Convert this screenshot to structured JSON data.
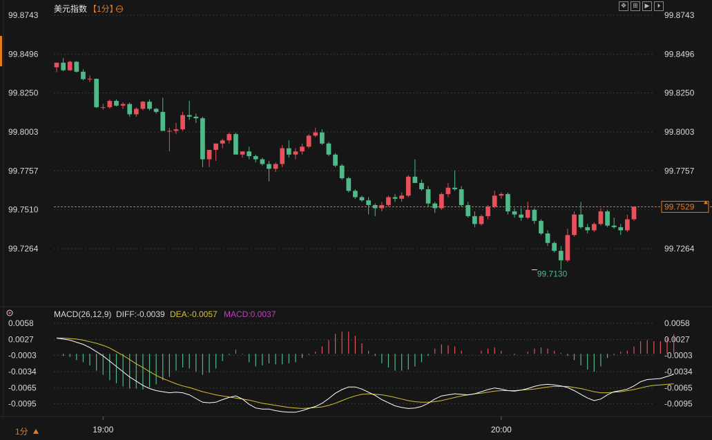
{
  "header": {
    "title": "美元指数",
    "period_tag": "【1分】",
    "crosshair_icon": "crosshair-icon"
  },
  "toolbar": {
    "buttons": [
      "fullscreen-icon",
      "grid-icon",
      "play-icon",
      "step-forward-icon"
    ]
  },
  "footer": {
    "period_label": "1分",
    "period_icon": "caret-up-icon"
  },
  "colors": {
    "up": "#e8505b",
    "down": "#4fb98a",
    "diff": "#ffffff",
    "dea": "#d7c531",
    "macd": "#c33ec3",
    "last_price": "#e87a1e"
  },
  "macd_legend": {
    "name": "MACD(26,12,9)",
    "diff": "DIFF:-0.0039",
    "dea": "DEA:-0.0057",
    "macd": "MACD:0.0037"
  },
  "chart_data": [
    {
      "type": "candlestick",
      "title": "美元指数【1分】",
      "ylim": [
        99.701,
        99.8743
      ],
      "y_ticks": [
        "99.8743",
        "99.8496",
        "99.8250",
        "99.8003",
        "99.7757",
        "99.7510",
        "99.7264"
      ],
      "x_ticks": [
        "19:00",
        "20:00"
      ],
      "x_tick_index": [
        7,
        67
      ],
      "last_price": 99.7529,
      "last_price_label": "99.7529",
      "low_annotation": {
        "index": 72,
        "value": 99.713,
        "label": "99.7130"
      },
      "ohlc": [
        [
          99.8413,
          99.8443,
          99.8382,
          99.8442
        ],
        [
          99.8442,
          99.8471,
          99.8388,
          99.8394
        ],
        [
          99.8394,
          99.8456,
          99.839,
          99.8448
        ],
        [
          99.8448,
          99.8452,
          99.838,
          99.8385
        ],
        [
          99.8385,
          99.84,
          99.833,
          99.8338
        ],
        [
          99.8338,
          99.836,
          99.832,
          99.834
        ],
        [
          99.834,
          99.8342,
          99.8155,
          99.816
        ],
        [
          99.816,
          99.8182,
          99.8145,
          99.816
        ],
        [
          99.816,
          99.821,
          99.815,
          99.82
        ],
        [
          99.82,
          99.821,
          99.8165,
          99.817
        ],
        [
          99.817,
          99.819,
          99.815,
          99.818
        ],
        [
          99.818,
          99.819,
          99.81,
          99.8115
        ],
        [
          99.8115,
          99.816,
          99.81,
          99.815
        ],
        [
          99.815,
          99.82,
          99.814,
          99.8195
        ],
        [
          99.8195,
          99.821,
          99.814,
          99.815
        ],
        [
          99.815,
          99.8155,
          99.812,
          99.813
        ],
        [
          99.813,
          99.822,
          99.81,
          99.801
        ],
        [
          99.801,
          99.803,
          99.788,
          99.801
        ],
        [
          99.801,
          99.806,
          99.799,
          99.802
        ],
        [
          99.802,
          99.813,
          99.801,
          99.811
        ],
        [
          99.811,
          99.82,
          99.808,
          99.81
        ],
        [
          99.81,
          99.812,
          99.806,
          99.809
        ],
        [
          99.809,
          99.81,
          99.778,
          99.783
        ],
        [
          99.783,
          99.785,
          99.778,
          99.789
        ],
        [
          99.789,
          99.79,
          99.782,
          99.793
        ],
        [
          99.793,
          99.796,
          99.79,
          99.795
        ],
        [
          99.795,
          99.8,
          99.793,
          99.799
        ],
        [
          99.799,
          99.8,
          99.79,
          99.786
        ],
        [
          99.786,
          99.788,
          99.784,
          99.788
        ],
        [
          99.788,
          99.791,
          99.783,
          99.785
        ],
        [
          99.785,
          99.786,
          99.781,
          99.783
        ],
        [
          99.783,
          99.784,
          99.779,
          99.78
        ],
        [
          99.78,
          99.782,
          99.769,
          99.777
        ],
        [
          99.777,
          99.781,
          99.775,
          99.78
        ],
        [
          99.78,
          99.792,
          99.778,
          99.79
        ],
        [
          99.79,
          99.795,
          99.784,
          99.786
        ],
        [
          99.786,
          99.79,
          99.783,
          99.788
        ],
        [
          99.788,
          99.793,
          99.786,
          99.791
        ],
        [
          99.791,
          99.799,
          99.79,
          99.798
        ],
        [
          99.798,
          99.803,
          99.797,
          99.8
        ],
        [
          99.8,
          99.802,
          99.792,
          99.793
        ],
        [
          99.793,
          99.794,
          99.785,
          99.786
        ],
        [
          99.786,
          99.787,
          99.778,
          99.779
        ],
        [
          99.779,
          99.78,
          99.77,
          99.771
        ],
        [
          99.771,
          99.772,
          99.762,
          99.763
        ],
        [
          99.763,
          99.764,
          99.758,
          99.759
        ],
        [
          99.759,
          99.76,
          99.756,
          99.757
        ],
        [
          99.757,
          99.759,
          99.748,
          99.754
        ],
        [
          99.754,
          99.755,
          99.747,
          99.752
        ],
        [
          99.752,
          99.756,
          99.75,
          99.754
        ],
        [
          99.754,
          99.76,
          99.753,
          99.759
        ],
        [
          99.759,
          99.761,
          99.756,
          99.758
        ],
        [
          99.758,
          99.762,
          99.756,
          99.76
        ],
        [
          99.76,
          99.773,
          99.759,
          99.772
        ],
        [
          99.772,
          99.783,
          99.769,
          99.768
        ],
        [
          99.768,
          99.77,
          99.763,
          99.764
        ],
        [
          99.764,
          99.766,
          99.753,
          99.755
        ],
        [
          99.755,
          99.756,
          99.749,
          99.752
        ],
        [
          99.752,
          99.762,
          99.751,
          99.761
        ],
        [
          99.761,
          99.768,
          99.759,
          99.765
        ],
        [
          99.765,
          99.776,
          99.763,
          99.764
        ],
        [
          99.764,
          99.766,
          99.753,
          99.754
        ],
        [
          99.754,
          99.756,
          99.746,
          99.747
        ],
        [
          99.747,
          99.75,
          99.74,
          99.742
        ],
        [
          99.742,
          99.748,
          99.741,
          99.747
        ],
        [
          99.747,
          99.754,
          99.745,
          99.753
        ],
        [
          99.753,
          99.763,
          99.752,
          99.76
        ],
        [
          99.76,
          99.762,
          99.758,
          99.761
        ],
        [
          99.761,
          99.762,
          99.748,
          99.75
        ],
        [
          99.75,
          99.752,
          99.746,
          99.748
        ],
        [
          99.748,
          99.752,
          99.744,
          99.746
        ],
        [
          99.746,
          99.756,
          99.745,
          99.751
        ],
        [
          99.751,
          99.752,
          99.742,
          99.744
        ],
        [
          99.744,
          99.745,
          99.735,
          99.736
        ],
        [
          99.736,
          99.738,
          99.728,
          99.73
        ],
        [
          99.73,
          99.731,
          99.724,
          99.725
        ],
        [
          99.725,
          99.728,
          99.713,
          99.719
        ],
        [
          99.719,
          99.739,
          99.718,
          99.735
        ],
        [
          99.735,
          99.75,
          99.734,
          99.748
        ],
        [
          99.748,
          99.756,
          99.739,
          99.74
        ],
        [
          99.74,
          99.742,
          99.736,
          99.738
        ],
        [
          99.738,
          99.743,
          99.737,
          99.742
        ],
        [
          99.742,
          99.752,
          99.741,
          99.75
        ],
        [
          99.75,
          99.751,
          99.74,
          99.741
        ],
        [
          99.741,
          99.746,
          99.739,
          99.74
        ],
        [
          99.74,
          99.742,
          99.735,
          99.738
        ],
        [
          99.738,
          99.748,
          99.737,
          99.745
        ],
        [
          99.745,
          99.753,
          99.744,
          99.7529
        ]
      ]
    },
    {
      "type": "macd",
      "params": "MACD(26,12,9)",
      "ylim": [
        -0.011,
        0.0062
      ],
      "y_ticks": [
        "0.0058",
        "0.0027",
        "-0.0003",
        "-0.0034",
        "-0.0065",
        "-0.0095"
      ],
      "diff": [
        0.003,
        0.0028,
        0.0026,
        0.0022,
        0.0018,
        0.0012,
        0.0004,
        -0.0004,
        -0.0014,
        -0.0024,
        -0.0034,
        -0.0044,
        -0.0052,
        -0.006,
        -0.0066,
        -0.007,
        -0.0072,
        -0.0074,
        -0.0073,
        -0.0074,
        -0.0078,
        -0.0085,
        -0.0092,
        -0.0093,
        -0.0092,
        -0.0087,
        -0.0083,
        -0.008,
        -0.0086,
        -0.0096,
        -0.0103,
        -0.0105,
        -0.0105,
        -0.0108,
        -0.011,
        -0.0111,
        -0.0111,
        -0.0108,
        -0.0104,
        -0.01,
        -0.0094,
        -0.0085,
        -0.0075,
        -0.0068,
        -0.0063,
        -0.0063,
        -0.0067,
        -0.0073,
        -0.0079,
        -0.0087,
        -0.0093,
        -0.0099,
        -0.0102,
        -0.0104,
        -0.0103,
        -0.01,
        -0.0094,
        -0.0086,
        -0.008,
        -0.0078,
        -0.0076,
        -0.0077,
        -0.0078,
        -0.0076,
        -0.0072,
        -0.0068,
        -0.0065,
        -0.0067,
        -0.007,
        -0.0071,
        -0.0069,
        -0.0066,
        -0.0062,
        -0.0059,
        -0.0058,
        -0.0059,
        -0.0061,
        -0.0064,
        -0.007,
        -0.0077,
        -0.0084,
        -0.0089,
        -0.0086,
        -0.0078,
        -0.0072,
        -0.007,
        -0.0067,
        -0.0061,
        -0.0053,
        -0.0049,
        -0.0048,
        -0.0047,
        -0.0043,
        -0.0039
      ],
      "dea": [
        0.003,
        0.003,
        0.0029,
        0.0028,
        0.0026,
        0.0023,
        0.002,
        0.0016,
        0.0011,
        0.0004,
        -0.0003,
        -0.0011,
        -0.0019,
        -0.0026,
        -0.0034,
        -0.0041,
        -0.0047,
        -0.0052,
        -0.0057,
        -0.0061,
        -0.0064,
        -0.0068,
        -0.0072,
        -0.0075,
        -0.0078,
        -0.008,
        -0.0082,
        -0.0084,
        -0.0086,
        -0.0088,
        -0.0091,
        -0.0094,
        -0.0096,
        -0.0098,
        -0.01,
        -0.0102,
        -0.0103,
        -0.0104,
        -0.0103,
        -0.0102,
        -0.0101,
        -0.0098,
        -0.0094,
        -0.0089,
        -0.0084,
        -0.008,
        -0.0077,
        -0.0076,
        -0.0077,
        -0.0078,
        -0.008,
        -0.0083,
        -0.0086,
        -0.0089,
        -0.0091,
        -0.0092,
        -0.0092,
        -0.0091,
        -0.0089,
        -0.0086,
        -0.0083,
        -0.008,
        -0.0078,
        -0.0076,
        -0.0075,
        -0.0073,
        -0.0071,
        -0.007,
        -0.007,
        -0.007,
        -0.0069,
        -0.0068,
        -0.0067,
        -0.0065,
        -0.0063,
        -0.0062,
        -0.0062,
        -0.0062,
        -0.0064,
        -0.0066,
        -0.0069,
        -0.0072,
        -0.0074,
        -0.0074,
        -0.0073,
        -0.0072,
        -0.007,
        -0.0068,
        -0.0065,
        -0.0062,
        -0.006,
        -0.0059,
        -0.0058,
        -0.0057
      ],
      "histogram": [
        0.0,
        -0.0004,
        -0.0006,
        -0.0012,
        -0.0016,
        -0.0022,
        -0.0032,
        -0.004,
        -0.005,
        -0.0056,
        -0.0062,
        -0.0066,
        -0.0066,
        -0.0068,
        -0.0064,
        -0.0058,
        -0.005,
        -0.0044,
        -0.0032,
        -0.0026,
        -0.0028,
        -0.0034,
        -0.004,
        -0.0036,
        -0.0028,
        -0.0014,
        -0.0002,
        0.0008,
        -0.0001,
        -0.0016,
        -0.0024,
        -0.0022,
        -0.0018,
        -0.002,
        -0.002,
        -0.0018,
        -0.0016,
        -0.0008,
        -0.0002,
        0.0004,
        0.0014,
        0.0026,
        0.0038,
        0.0042,
        0.0042,
        0.0034,
        0.002,
        0.0006,
        -0.0004,
        -0.0018,
        -0.0026,
        -0.0032,
        -0.0032,
        -0.003,
        -0.0024,
        -0.0016,
        -0.0004,
        0.001,
        0.0018,
        0.0016,
        0.0014,
        0.0006,
        0.0,
        0.0,
        0.0006,
        0.001,
        0.0012,
        0.0006,
        0.0,
        -0.0002,
        0.0,
        0.0004,
        0.001,
        0.0012,
        0.001,
        0.0006,
        0.0002,
        -0.0004,
        -0.0012,
        -0.0022,
        -0.003,
        -0.0034,
        -0.0024,
        -0.0008,
        -0.0002,
        0.0004,
        0.0006,
        0.0014,
        0.0024,
        0.0026,
        0.0024,
        0.0024,
        0.003,
        0.0037
      ]
    }
  ]
}
